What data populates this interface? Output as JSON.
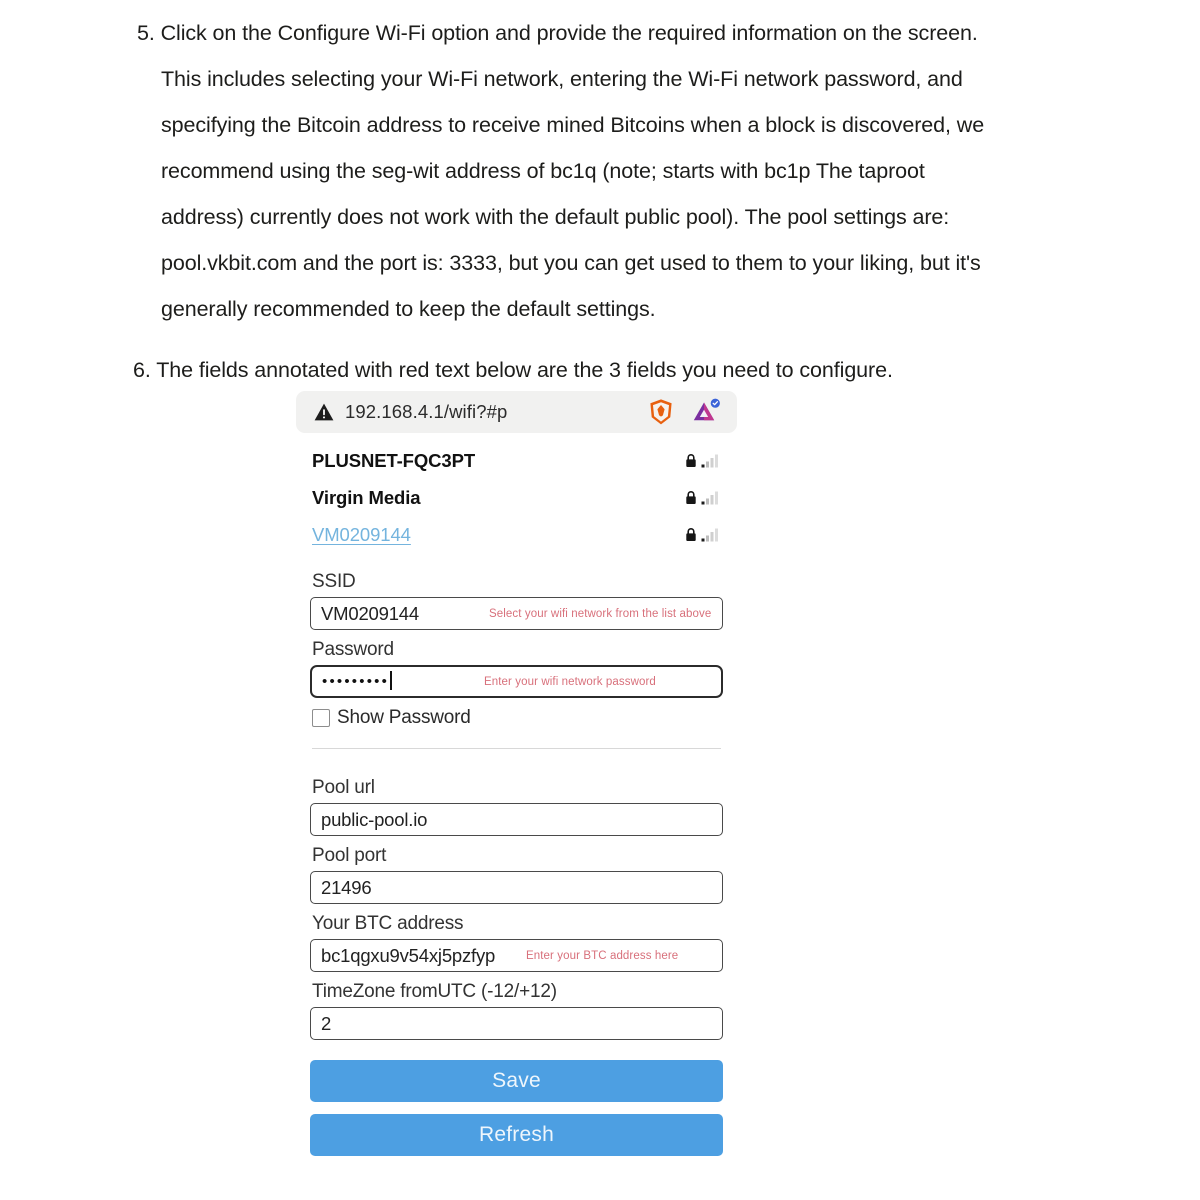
{
  "document": {
    "step5": "5. Click on the Configure Wi-Fi option and provide the required information on the screen. This includes selecting your Wi-Fi network, entering the Wi-Fi network password, and specifying the Bitcoin address to receive mined Bitcoins when a block is discovered, we recommend using the seg-wit address of bc1q (note; starts with bc1p The taproot address) currently does not work with the default public pool). The pool settings are: pool.vkbit.com and the port is: 3333, but you can get used to them to your liking, but it's generally recommended to keep the default settings.",
    "step6": "6.  The fields annotated with red text below are the 3 fields you need to configure."
  },
  "browser": {
    "url": "192.168.4.1/wifi?#p",
    "warning_icon": "warning-triangle-icon",
    "brave_icon": "brave-shield-icon",
    "extension_icon": "extension-triangle-icon"
  },
  "networks": [
    {
      "ssid": "PLUSNET-FQC3PT",
      "selected": false,
      "lock": "lock-icon",
      "signal": "signal-bars-icon"
    },
    {
      "ssid": "Virgin Media",
      "selected": false,
      "lock": "lock-icon",
      "signal": "signal-bars-icon"
    },
    {
      "ssid": "VM0209144",
      "selected": true,
      "lock": "lock-icon",
      "signal": "signal-bars-icon"
    }
  ],
  "form": {
    "ssid": {
      "label": "SSID",
      "value": "VM0209144",
      "annotation": "Select your wifi network from the list above"
    },
    "password": {
      "label": "Password",
      "value": "•••••••••",
      "annotation": "Enter your wifi network password"
    },
    "show_password": {
      "label": "Show Password",
      "checked": false
    },
    "pool_url": {
      "label": "Pool url",
      "value": "public-pool.io"
    },
    "pool_port": {
      "label": "Pool port",
      "value": "21496"
    },
    "btc_address": {
      "label": "Your BTC address",
      "value": "bc1qgxu9v54xj5pzfyp",
      "annotation": "Enter your BTC address here"
    },
    "timezone": {
      "label": "TimeZone fromUTC (-12/+12)",
      "value": "2"
    }
  },
  "buttons": {
    "save": "Save",
    "refresh": "Refresh"
  },
  "colors": {
    "button_blue": "#4d9fe2",
    "link_blue": "#74b4de",
    "annotation_red": "#d8707b",
    "urlbar_bg": "#f1f1f0"
  }
}
